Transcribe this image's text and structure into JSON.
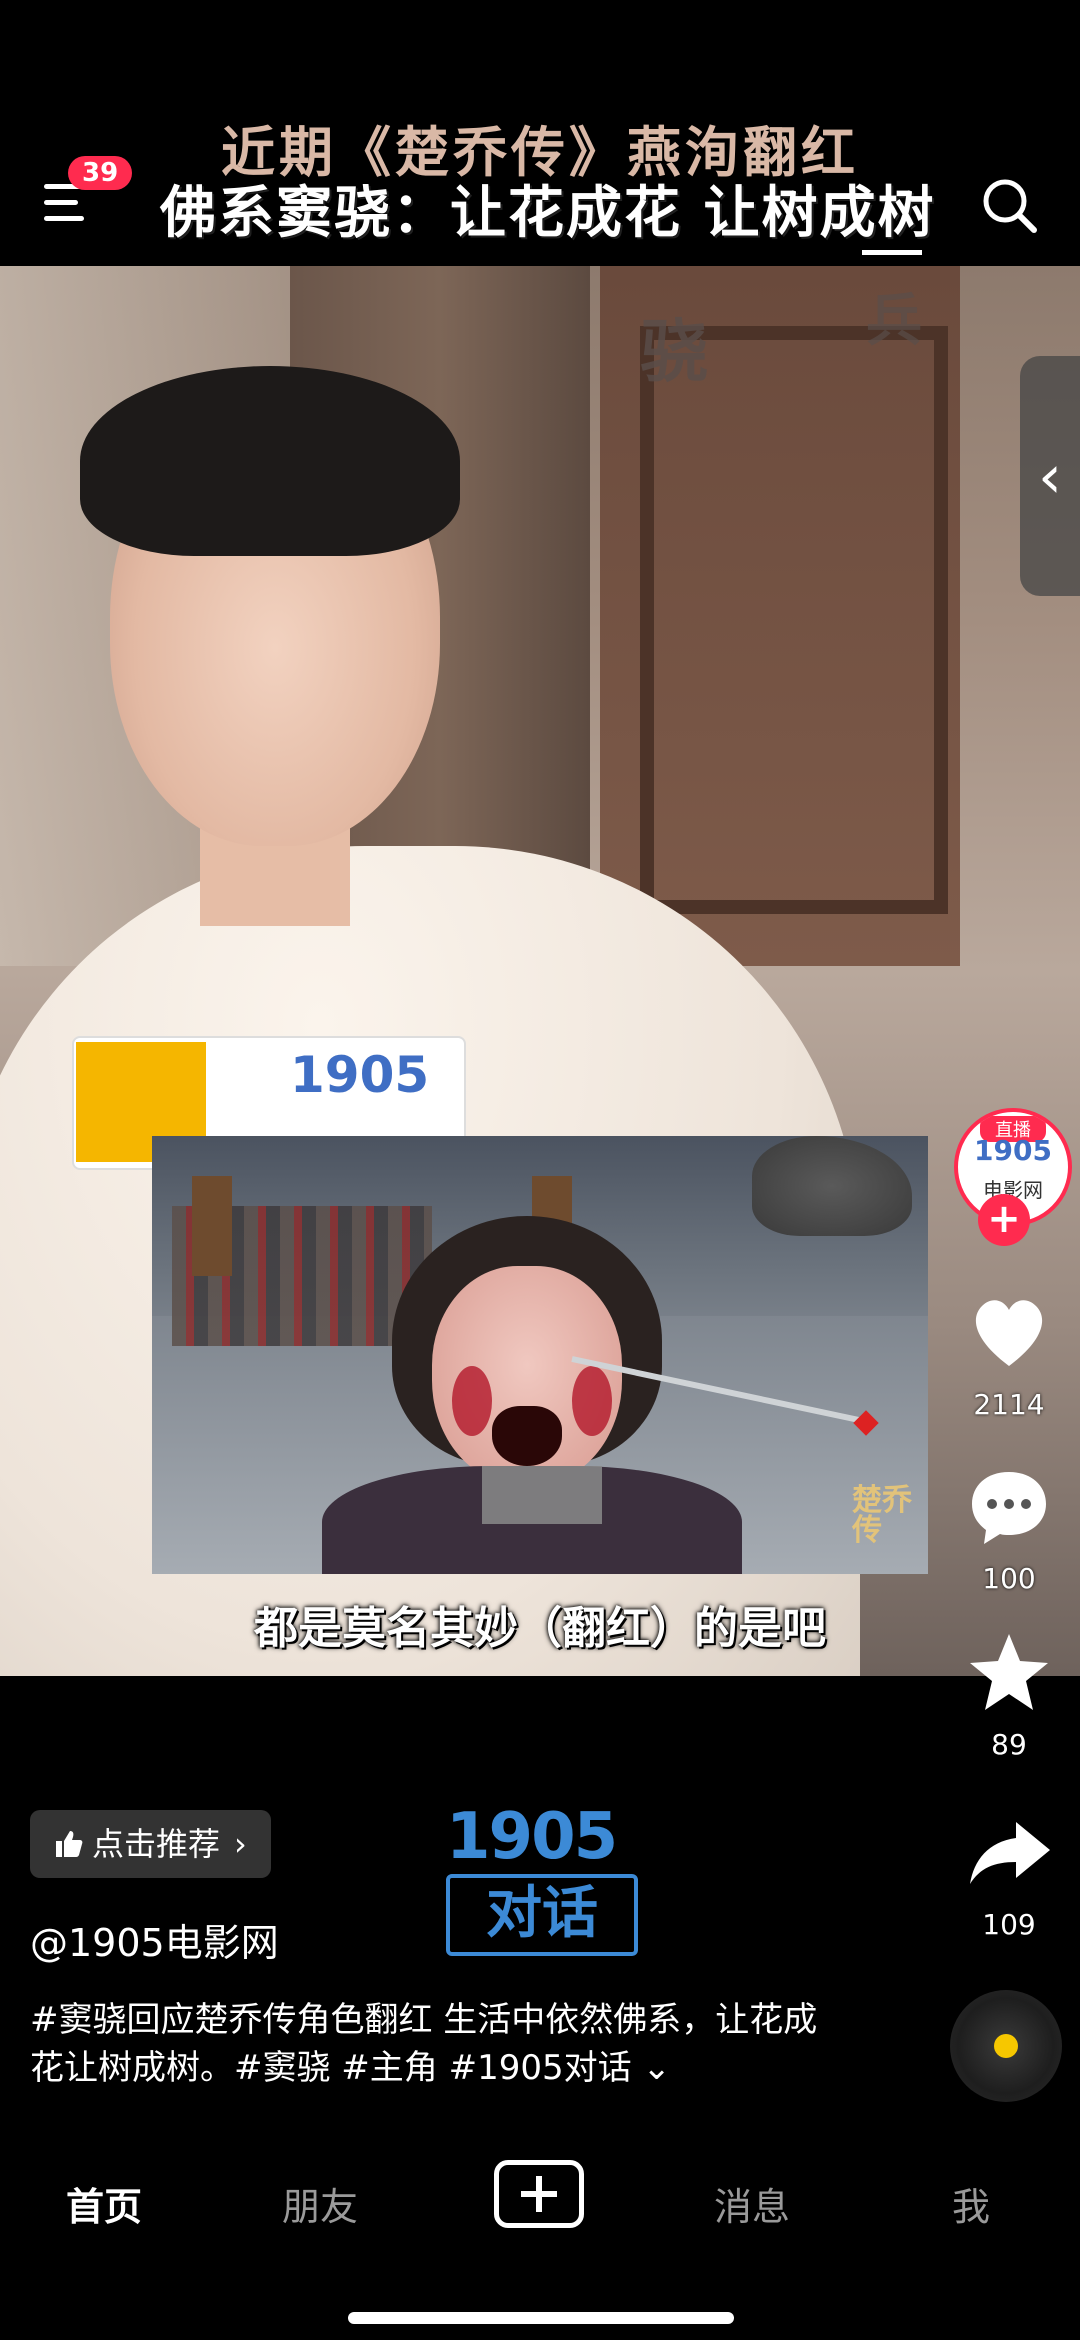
{
  "header": {
    "headline": "近期《楚乔传》燕洵翻红",
    "menu_badge": "39",
    "overlay_title": "佛系窦骁：让花成花 让树成树"
  },
  "video": {
    "wall_chars": [
      "骁",
      "兵"
    ],
    "mic_logo": "1905",
    "clip_watermark": "楚乔传",
    "subtitle": "都是莫名其妙（翻红）的是吧"
  },
  "actions": {
    "avatar_live": "直播",
    "avatar_logo": "1905",
    "avatar_sub": "电影网",
    "likes": "2114",
    "comments": "100",
    "favorites": "89",
    "shares": "109"
  },
  "info": {
    "recommend_label": "点击推荐",
    "brand_number": "1905",
    "brand_dialog": "对话",
    "handle": "@1905电影网",
    "description": "#窦骁回应楚乔传角色翻红 生活中依然佛系，让花成花让树成树。#窦骁 #主角 #1905对话"
  },
  "nav": {
    "home": "首页",
    "friends": "朋友",
    "messages": "消息",
    "me": "我"
  },
  "colors": {
    "accent": "#ff2b4f",
    "brand_blue": "#3c8ad6",
    "headline": "#d9b8a6"
  }
}
